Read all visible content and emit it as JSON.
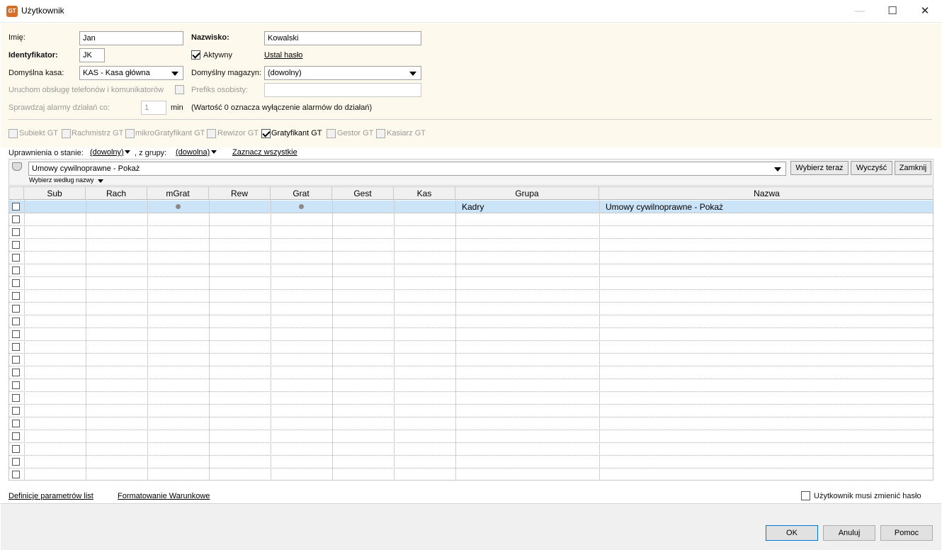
{
  "window": {
    "title": "Użytkownik",
    "app_icon_text": "GT",
    "minimize_glyph": "—",
    "maximize_glyph": "☐",
    "close_glyph": "✕"
  },
  "form": {
    "first_name_label": "Imię:",
    "first_name_value": "Jan",
    "last_name_label": "Nazwisko:",
    "last_name_value": "Kowalski",
    "identifier_label": "Identyfikator:",
    "identifier_value": "JK",
    "active_label": "Aktywny",
    "active_checked": true,
    "set_password_link": "Ustal hasło",
    "default_cash_label": "Domyślna kasa:",
    "default_cash_value": "KAS - Kasa główna",
    "default_warehouse_label": "Domyślny magazyn:",
    "default_warehouse_value": "(dowolny)",
    "phone_service_label": "Uruchom obsługę telefonów i komunikatorów",
    "personal_prefix_label": "Prefiks osobisty:",
    "personal_prefix_value": "",
    "alarm_check_label": "Sprawdzaj alarmy działań co:",
    "alarm_value": "1",
    "alarm_unit": "min",
    "alarm_note": "(Wartość 0 oznacza wyłączenie alarmów do działań)"
  },
  "modules": [
    {
      "label": "Subiekt GT",
      "checked": false
    },
    {
      "label": "Rachmistrz GT",
      "checked": false
    },
    {
      "label": "mikroGratyfikant GT",
      "checked": false
    },
    {
      "label": "Rewizor GT",
      "checked": false
    },
    {
      "label": "Gratyfikant GT",
      "checked": true
    },
    {
      "label": "Gestor GT",
      "checked": false
    },
    {
      "label": "Kasiarz GT",
      "checked": false
    }
  ],
  "permissions": {
    "state_label": "Uprawnienia o stanie:",
    "state_value": "(dowolny)",
    "group_label": ", z grupy:",
    "group_value": "(dowolna)",
    "select_all_link": "Zaznacz wszystkie",
    "search_value": "Umowy cywilnoprawne - Pokaż",
    "search_by": "Wybierz według nazwy",
    "select_now_button": "Wybierz teraz",
    "clear_button": "Wyczyść",
    "close_button": "Zamknij"
  },
  "grid": {
    "columns": [
      "Sub",
      "Rach",
      "mGrat",
      "Rew",
      "Grat",
      "Gest",
      "Kas",
      "Grupa",
      "Nazwa"
    ],
    "rows": [
      {
        "selected": true,
        "mGrat": true,
        "Grat": true,
        "group": "Kadry",
        "name": "Umowy cywilnoprawne - Pokaż"
      }
    ],
    "empty_row_count": 21
  },
  "footer": {
    "list_params_link": "Definicje parametrów list",
    "conditional_formatting_link": "Formatowanie Warunkowe",
    "must_change_password_label": "Użytkownik musi zmienić hasło",
    "ok_button": "OK",
    "cancel_button": "Anuluj",
    "help_button": "Pomoc"
  }
}
